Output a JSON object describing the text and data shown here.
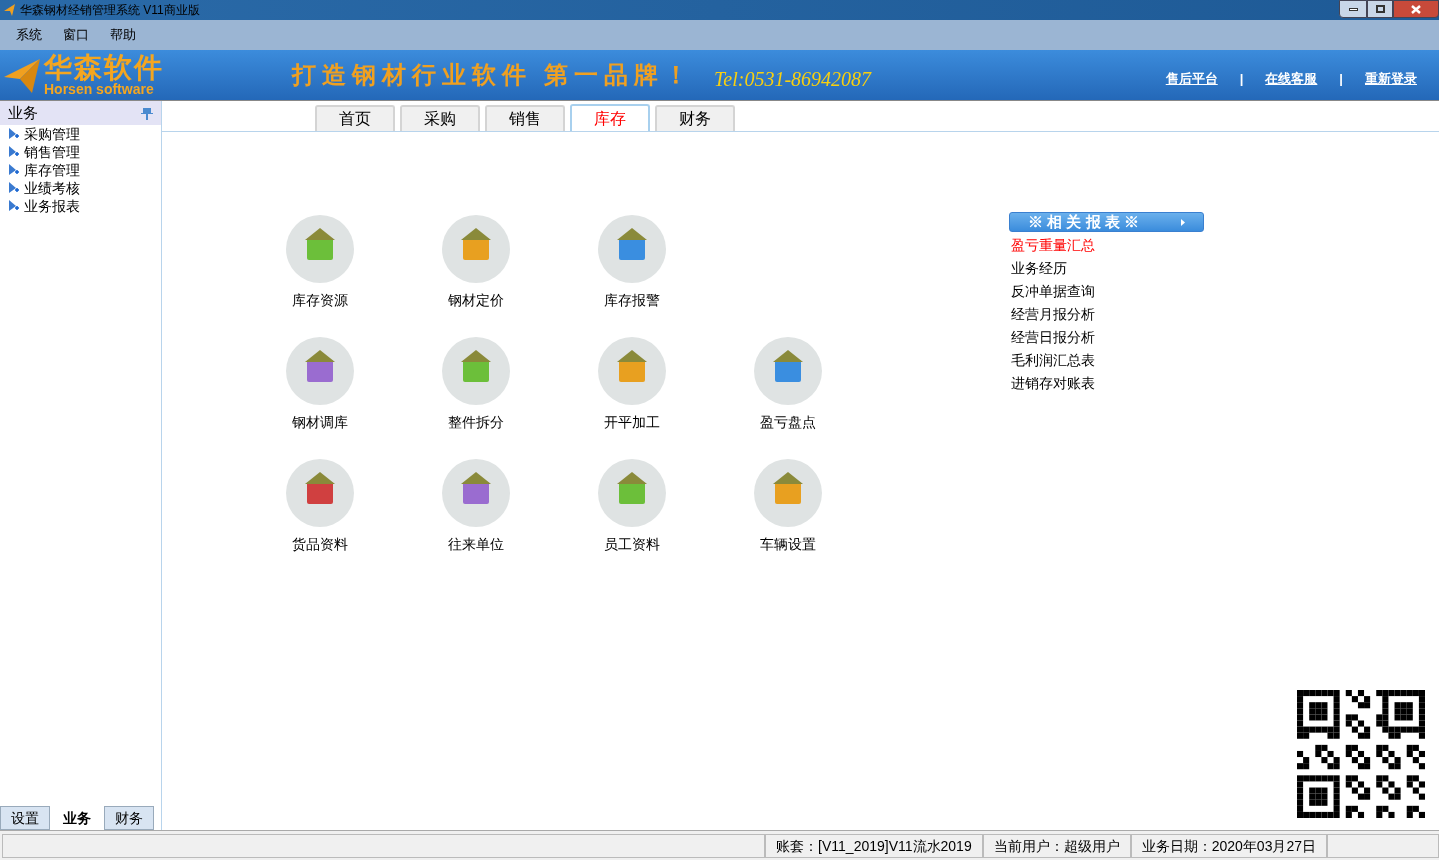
{
  "window": {
    "title": "华森钢材经销管理系统 V11商业版"
  },
  "menu": [
    "系统",
    "窗口",
    "帮助"
  ],
  "banner": {
    "logo_cn": "华森软件",
    "logo_en": "Horsen software",
    "slogan": "打造钢材行业软件 第一品牌！",
    "tel": "Tel:0531-86942087",
    "links": [
      "售后平台",
      "在线客服",
      "重新登录"
    ],
    "separator": "|"
  },
  "sidebar": {
    "title": "业务",
    "items": [
      "采购管理",
      "销售管理",
      "库存管理",
      "业绩考核",
      "业务报表"
    ],
    "bottom_tabs": [
      {
        "label": "设置",
        "selected": false
      },
      {
        "label": "业务",
        "selected": true
      },
      {
        "label": "财务",
        "selected": false
      }
    ]
  },
  "tabs": [
    {
      "label": "首页",
      "selected": false
    },
    {
      "label": "采购",
      "selected": false
    },
    {
      "label": "销售",
      "selected": false
    },
    {
      "label": "库存",
      "selected": true
    },
    {
      "label": "财务",
      "selected": false
    }
  ],
  "icon_rows": [
    [
      {
        "label": "库存资源"
      },
      {
        "label": "钢材定价"
      },
      {
        "label": "库存报警"
      }
    ],
    [
      {
        "label": "钢材调库"
      },
      {
        "label": "整件拆分"
      },
      {
        "label": "开平加工"
      },
      {
        "label": "盈亏盘点"
      }
    ],
    [
      {
        "label": "货品资料"
      },
      {
        "label": "往来单位"
      },
      {
        "label": "员工资料"
      },
      {
        "label": "车辆设置"
      }
    ]
  ],
  "reports": {
    "title": "※ 相 关 报 表 ※",
    "items": [
      {
        "label": "盈亏重量汇总",
        "highlighted": true
      },
      {
        "label": "业务经历",
        "highlighted": false
      },
      {
        "label": "反冲单据查询",
        "highlighted": false
      },
      {
        "label": "经营月报分析",
        "highlighted": false
      },
      {
        "label": "经营日报分析",
        "highlighted": false
      },
      {
        "label": "毛利润汇总表",
        "highlighted": false
      },
      {
        "label": "进销存对账表",
        "highlighted": false
      }
    ]
  },
  "status_bar": [
    "账套：[V11_2019]V11流水2019",
    "当前用户：超级用户",
    "业务日期：2020年03月27日"
  ]
}
